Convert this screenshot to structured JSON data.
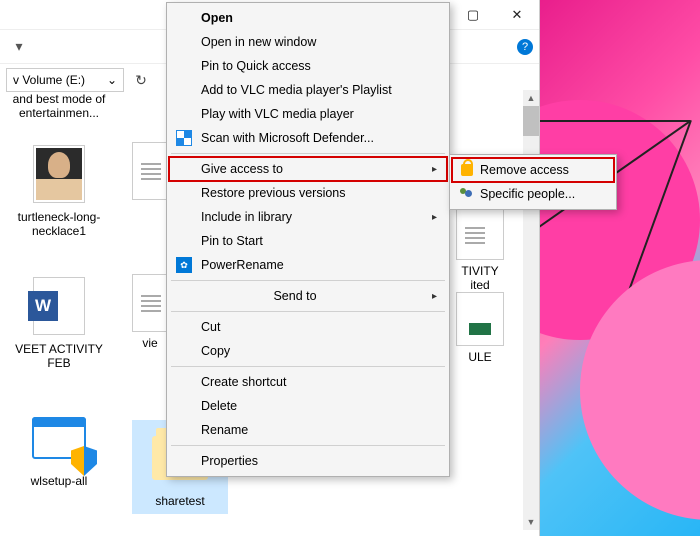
{
  "titlebar": {
    "maximize_glyph": "▢",
    "close_glyph": "✕"
  },
  "navbar": {
    "down_glyph": "▾",
    "help_glyph": "?"
  },
  "address": {
    "path_text": "v Volume (E:)",
    "dropdown_glyph": "⌄",
    "refresh_glyph": "↻"
  },
  "scrollbar": {
    "up": "▲",
    "down": "▼"
  },
  "items": {
    "row0": {
      "label": "and best mode of entertainmen..."
    },
    "img": {
      "label": "turtleneck-long-necklace1"
    },
    "word": {
      "label": "VEET ACTIVITY FEB",
      "badge": "W"
    },
    "exe": {
      "label": "wlsetup-all"
    },
    "doc1": {
      "label": "vie"
    },
    "folder_sel": {
      "label": "sharetest"
    },
    "partial_right1": "TIVITY",
    "partial_right2": "ited",
    "partial_right3": "ULE"
  },
  "ctx": {
    "open": "Open",
    "open_new": "Open in new window",
    "pin_quick": "Pin to Quick access",
    "add_vlc": "Add to VLC media player's Playlist",
    "play_vlc": "Play with VLC media player",
    "defender": "Scan with Microsoft Defender...",
    "give_access": "Give access to",
    "restore": "Restore previous versions",
    "include_lib": "Include in library",
    "pin_start": "Pin to Start",
    "powerrename": "PowerRename",
    "send_to": "Send to",
    "cut": "Cut",
    "copy": "Copy",
    "shortcut": "Create shortcut",
    "delete": "Delete",
    "rename": "Rename",
    "properties": "Properties",
    "arrow": "▸",
    "pr_badge": "✿"
  },
  "submenu": {
    "remove": "Remove access",
    "specific": "Specific people..."
  }
}
